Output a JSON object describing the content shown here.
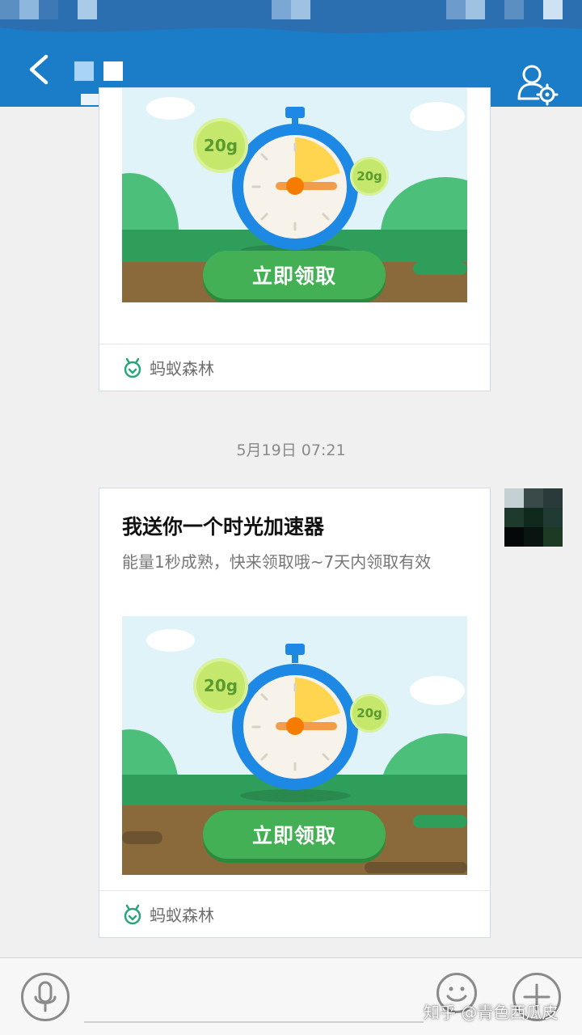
{
  "nav": {
    "title": "■ ■",
    "back_icon": "chevron-left-icon",
    "profile_icon": "user-settings-icon"
  },
  "messages": [
    {
      "type": "promo_card",
      "banner": {
        "chip_large": "20g",
        "chip_small": "20g",
        "button_label": "立即领取"
      },
      "source": {
        "icon": "ant-forest-icon",
        "label": "蚂蚁森林"
      }
    },
    {
      "type": "timestamp",
      "text": "5月19日 07:21"
    },
    {
      "type": "promo_card",
      "title": "我送你一个时光加速器",
      "description": "能量1秒成熟，快来领取哦~7天内领取有效",
      "banner": {
        "chip_large": "20g",
        "chip_small": "20g",
        "button_label": "立即领取"
      },
      "source": {
        "icon": "ant-forest-icon",
        "label": "蚂蚁森林"
      }
    }
  ],
  "input_bar": {
    "voice_icon": "microphone-icon",
    "emoji_icon": "smiley-icon",
    "plus_icon": "plus-icon",
    "text_value": ""
  },
  "watermark": "知乎 @青色西瓜皮",
  "colors": {
    "header": "#1b7cc8",
    "claim_button": "#44b055",
    "card_border": "#c9ddee"
  }
}
